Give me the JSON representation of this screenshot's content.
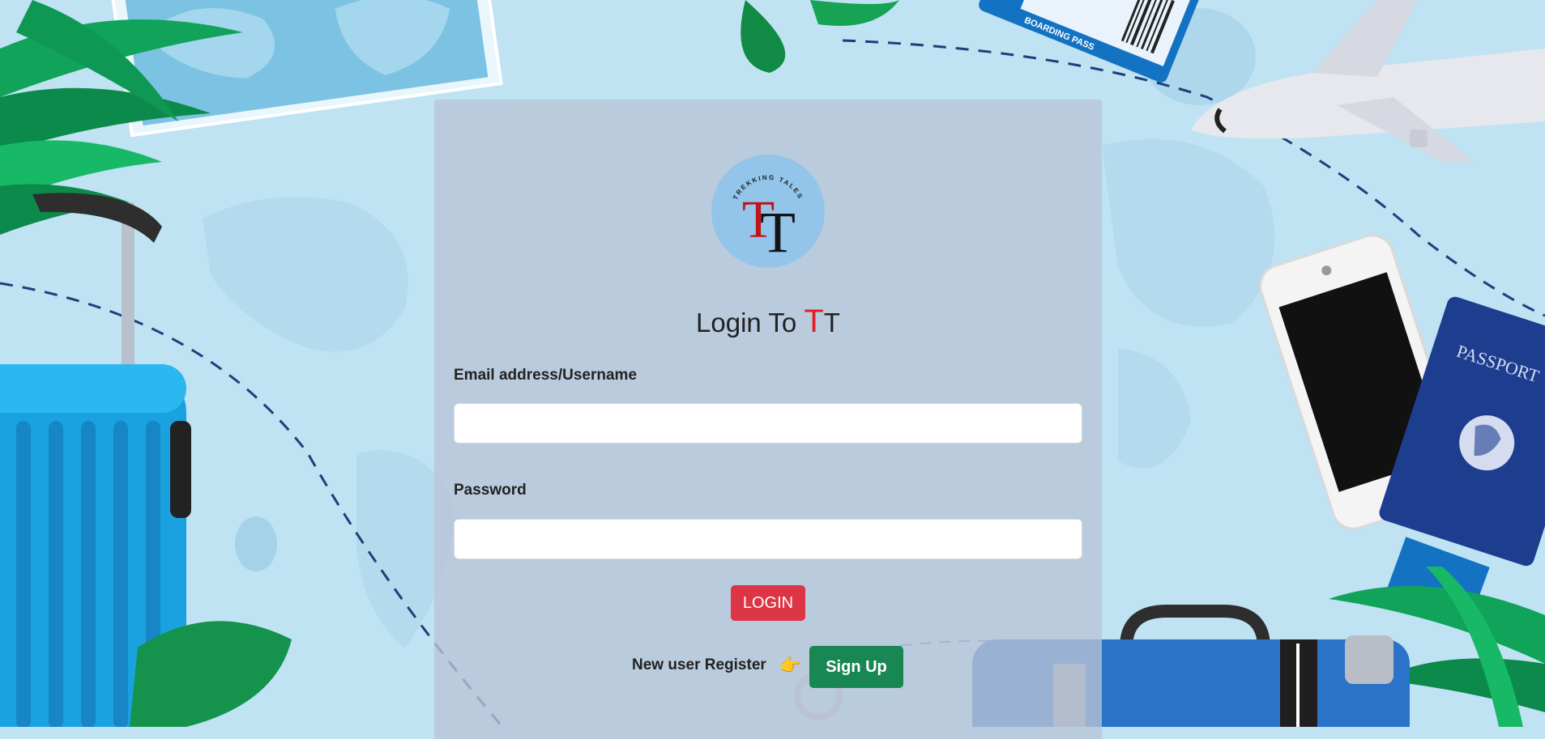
{
  "logo": {
    "ring_text": "TREKKING TALES",
    "letter_red": "T",
    "letter_black": "T"
  },
  "form": {
    "title_prefix": "Login To ",
    "title_red": "T",
    "title_suffix": "T",
    "email_label": "Email address/Username",
    "email_value": "",
    "password_label": "Password",
    "password_value": "",
    "login_label": "LOGIN",
    "register_text": "New user Register",
    "pointer_icon": "👉",
    "signup_label": "Sign Up"
  },
  "background": {
    "boarding_pass_text": "BOARDING PASS",
    "passport_text": "PASSPORT"
  },
  "colors": {
    "accent_red": "#dc3545",
    "accent_green": "#198754",
    "logo_red": "#c0141a"
  }
}
